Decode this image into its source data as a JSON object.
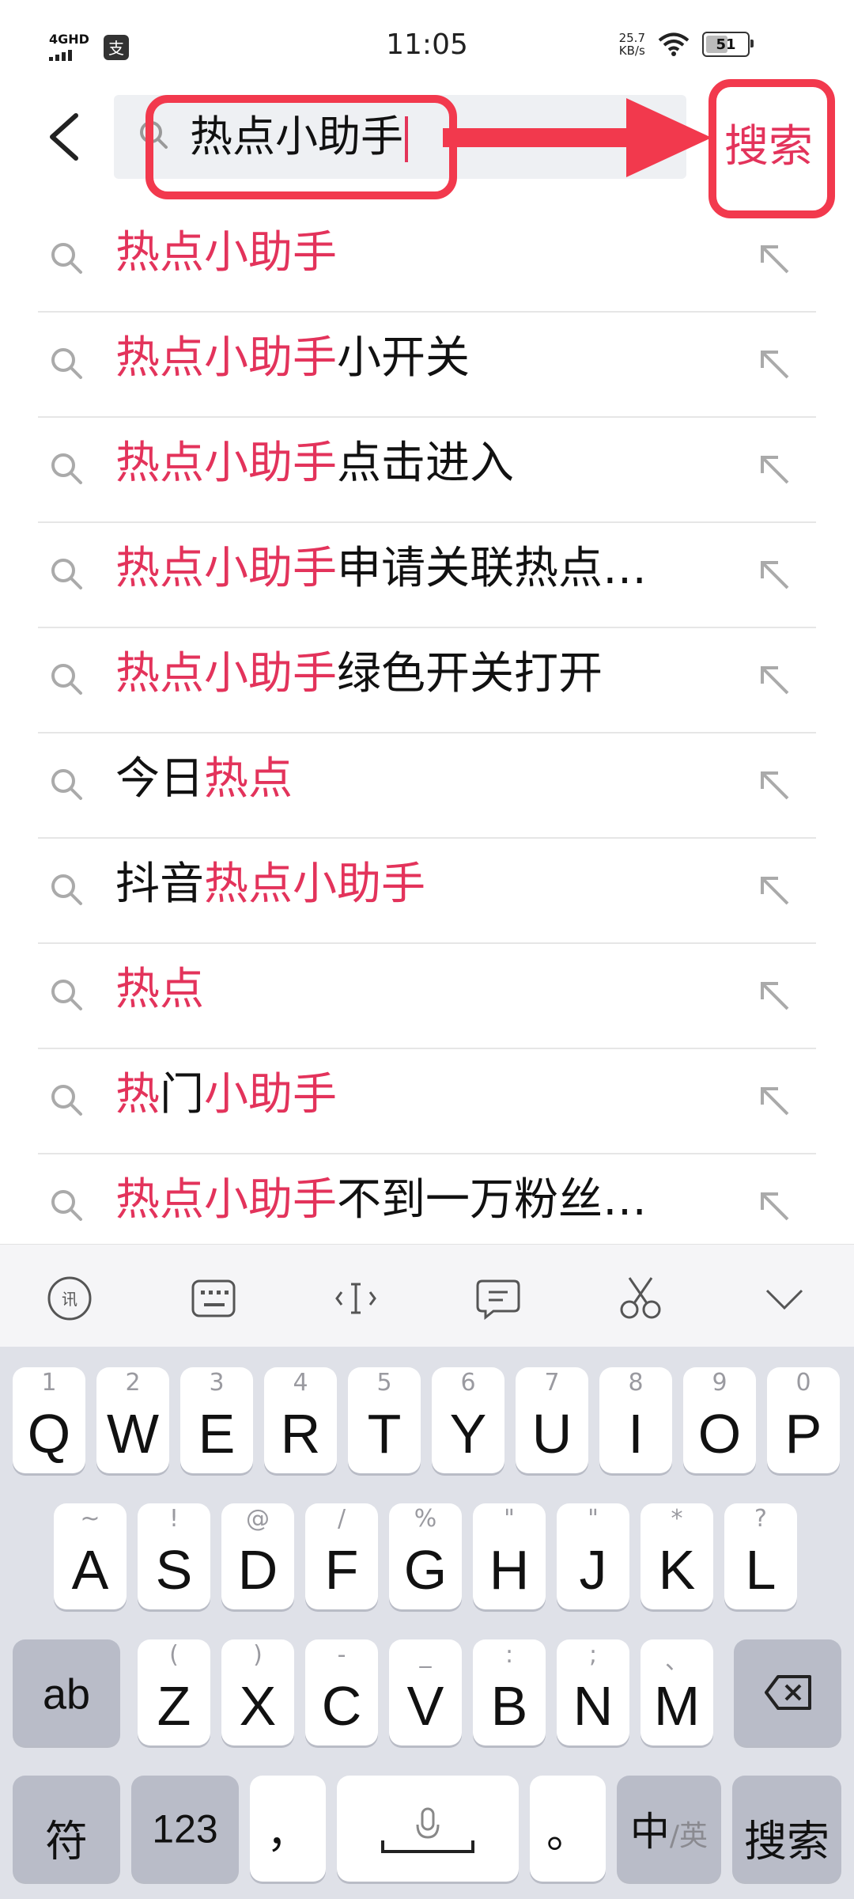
{
  "status_bar": {
    "network": "4GHD",
    "time": "11:05",
    "speed_value": "25.7",
    "speed_unit": "KB/s",
    "battery": "51",
    "app_icon_char": "支"
  },
  "search": {
    "query": "热点小助手",
    "submit_label": "搜索"
  },
  "suggestions": [
    {
      "hi": "热点小助手",
      "rest": ""
    },
    {
      "hi": "热点小助手",
      "rest": "小开关"
    },
    {
      "hi": "热点小助手",
      "rest": "点击进入"
    },
    {
      "hi": "热点小助手",
      "rest": "申请关联热点…"
    },
    {
      "hi": "热点小助手",
      "rest": "绿色开关打开"
    },
    {
      "pre": "今日",
      "hi": "热点"
    },
    {
      "pre": "抖音",
      "hi": "热点小助手"
    },
    {
      "hi": "热点"
    },
    {
      "hi": "热",
      "pre2": "门",
      "hi2": "小助手"
    },
    {
      "hi": "热点小助手",
      "rest": "不到一万粉丝…"
    }
  ],
  "keyboard": {
    "row1": [
      {
        "k": "Q",
        "s": "1"
      },
      {
        "k": "W",
        "s": "2"
      },
      {
        "k": "E",
        "s": "3"
      },
      {
        "k": "R",
        "s": "4"
      },
      {
        "k": "T",
        "s": "5"
      },
      {
        "k": "Y",
        "s": "6"
      },
      {
        "k": "U",
        "s": "7"
      },
      {
        "k": "I",
        "s": "8"
      },
      {
        "k": "O",
        "s": "9"
      },
      {
        "k": "P",
        "s": "0"
      }
    ],
    "row2": [
      {
        "k": "A",
        "s": "~"
      },
      {
        "k": "S",
        "s": "!"
      },
      {
        "k": "D",
        "s": "@"
      },
      {
        "k": "F",
        "s": "/"
      },
      {
        "k": "G",
        "s": "%"
      },
      {
        "k": "H",
        "s": "\""
      },
      {
        "k": "J",
        "s": "\""
      },
      {
        "k": "K",
        "s": "*"
      },
      {
        "k": "L",
        "s": "?"
      }
    ],
    "row3": [
      {
        "k": "Z",
        "s": "("
      },
      {
        "k": "X",
        "s": ")"
      },
      {
        "k": "C",
        "s": "-"
      },
      {
        "k": "V",
        "s": "_"
      },
      {
        "k": "B",
        "s": ":"
      },
      {
        "k": "N",
        "s": ";"
      },
      {
        "k": "M",
        "s": "、"
      }
    ],
    "ab_label": "ab",
    "symbol_label": "符",
    "num_label": "123",
    "comma_label": "，",
    "period_label": "。",
    "lang_primary": "中",
    "lang_secondary": "/英",
    "enter_label": "搜索"
  },
  "colors": {
    "accent": "#e3335b",
    "annotation": "#f2394d",
    "keyboard_bg": "#dfe1e8"
  }
}
